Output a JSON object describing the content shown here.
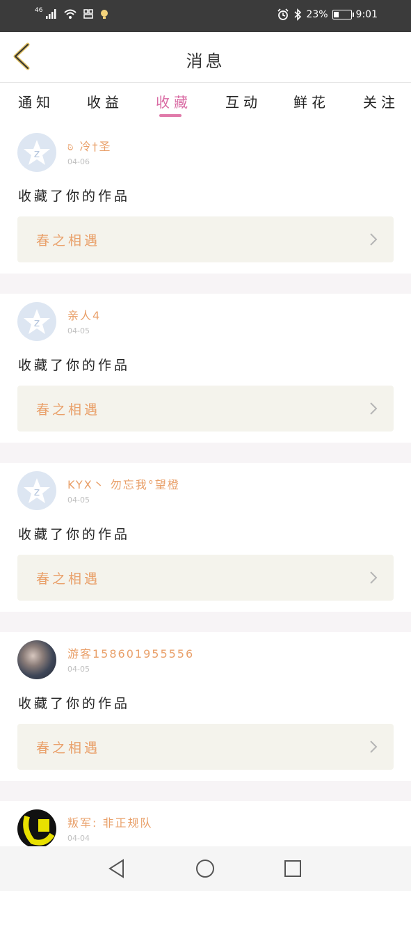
{
  "status_bar": {
    "network": "46",
    "battery_percent": "23%",
    "time": "9:01",
    "icons": [
      "signal-icon",
      "wifi-icon",
      "sim-icon",
      "notification-icon",
      "alarm-icon",
      "bluetooth-icon",
      "battery-icon"
    ]
  },
  "header": {
    "title": "消息",
    "back_icon": "chevron-left-icon"
  },
  "tabs": [
    {
      "label": "通知",
      "active": false
    },
    {
      "label": "收益",
      "active": false
    },
    {
      "label": "收藏",
      "active": true
    },
    {
      "label": "互动",
      "active": false
    },
    {
      "label": "鲜花",
      "active": false
    },
    {
      "label": "关注",
      "active": false
    }
  ],
  "messages": [
    {
      "username": "ಠಿ 冷†圣",
      "date": "04-06",
      "text": "收藏了你的作品",
      "work": "春之相遇",
      "avatar": "default-star-avatar"
    },
    {
      "username": "亲人4",
      "date": "04-05",
      "text": "收藏了你的作品",
      "work": "春之相遇",
      "avatar": "default-star-avatar"
    },
    {
      "username": "KYX丶 勿忘我°望橙",
      "date": "04-05",
      "text": "收藏了你的作品",
      "work": "春之相遇",
      "avatar": "default-star-avatar"
    },
    {
      "username": "游客158601955556",
      "date": "04-05",
      "text": "收藏了你的作品",
      "work": "春之相遇",
      "avatar": "photo-avatar"
    },
    {
      "username": "叛军: 非正规队",
      "date": "04-04",
      "text": "",
      "work": "",
      "avatar": "yellow-avatar"
    }
  ],
  "colors": {
    "accent": "#d96aa3",
    "username": "#e9a06a",
    "status_bar": "#3b3b3b",
    "work_bg": "#f4f3ec"
  }
}
